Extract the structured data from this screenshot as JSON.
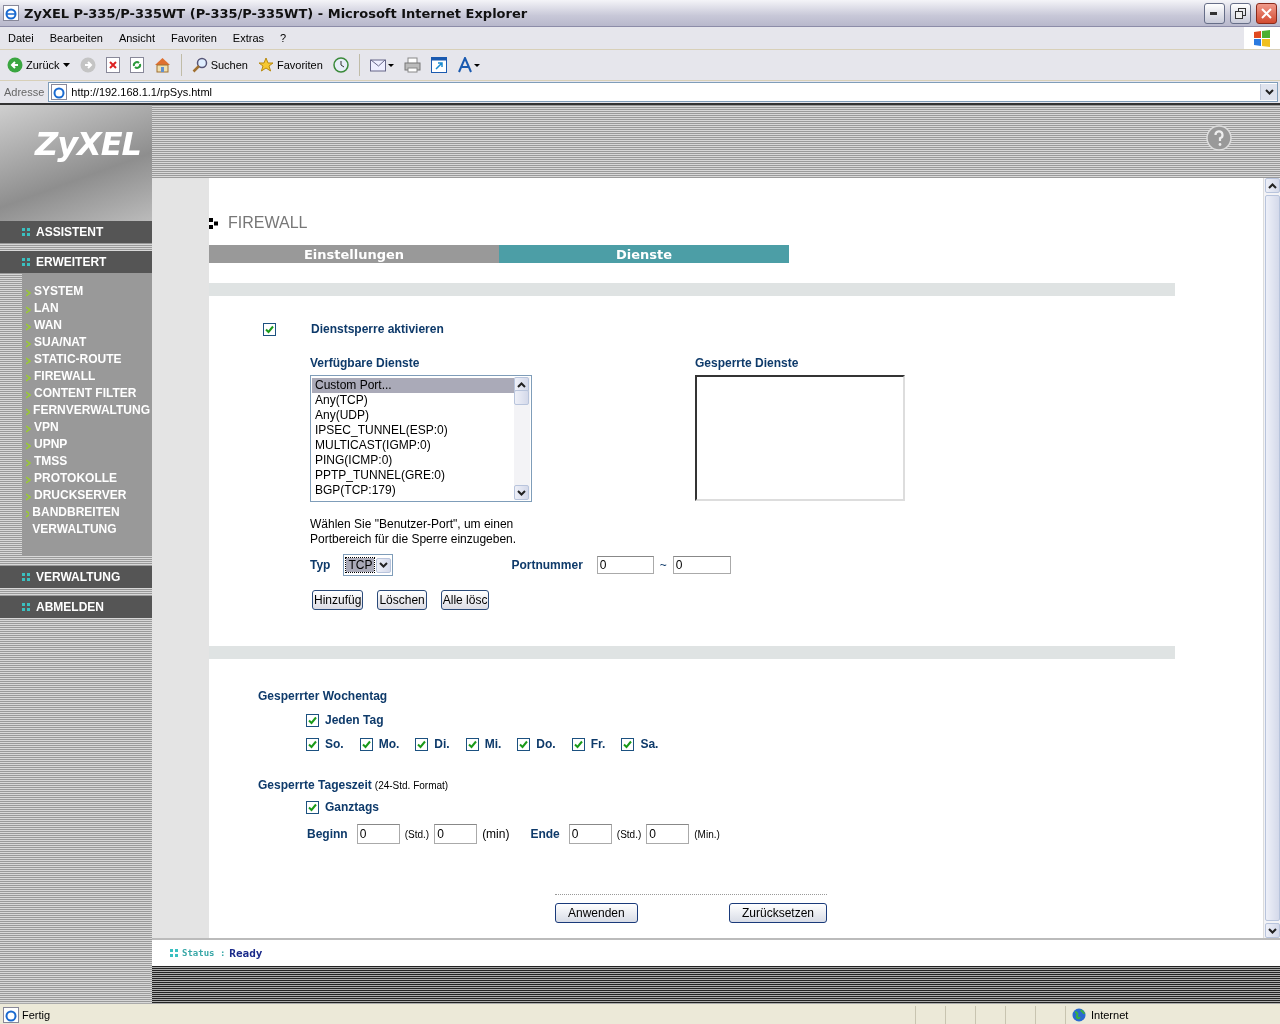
{
  "window": {
    "title": "ZyXEL P-335/P-335WT (P-335/P-335WT) - Microsoft Internet Explorer"
  },
  "menu": [
    "Datei",
    "Bearbeiten",
    "Ansicht",
    "Favoriten",
    "Extras",
    "?"
  ],
  "toolbar": [
    {
      "kind": "back",
      "label": "Zurück"
    },
    {
      "kind": "forward"
    },
    {
      "kind": "stop"
    },
    {
      "kind": "refresh"
    },
    {
      "kind": "home"
    },
    {
      "kind": "search",
      "label": "Suchen"
    },
    {
      "kind": "favorites",
      "label": "Favoriten"
    },
    {
      "kind": "history"
    },
    {
      "kind": "mail"
    },
    {
      "kind": "print"
    },
    {
      "kind": "window"
    },
    {
      "kind": "font"
    }
  ],
  "address": {
    "label": "Adresse",
    "url": "http://192.168.1.1/rpSys.html"
  },
  "logo": "ZyXEL",
  "nav": [
    {
      "label": "ASSISTENT"
    },
    {
      "label": "ERWEITERT",
      "children": [
        "SYSTEM",
        "LAN",
        "WAN",
        "SUA/NAT",
        "STATIC-ROUTE",
        "FIREWALL",
        "CONTENT FILTER",
        "FERNVERWALTUNG",
        "VPN",
        "UPNP",
        "TMSS",
        "PROTOKOLLE",
        "DRUCKSERVER",
        "BANDBREITEN VERWALTUNG"
      ]
    },
    {
      "label": "VERWALTUNG"
    },
    {
      "label": "ABMELDEN"
    }
  ],
  "page_title": "FIREWALL",
  "tabs": [
    {
      "label": "Einstellungen",
      "selected": false
    },
    {
      "label": "Dienste",
      "selected": true
    }
  ],
  "service_block": {
    "label": "Dienstsperre aktivieren",
    "checked": true
  },
  "available": {
    "heading": "Verfügbare Dienste",
    "items": [
      {
        "label": "Custom Port...",
        "selected": true
      },
      {
        "label": "Any(TCP)",
        "selected": false
      },
      {
        "label": "Any(UDP)",
        "selected": false
      },
      {
        "label": "IPSEC_TUNNEL(ESP:0)",
        "selected": false
      },
      {
        "label": "MULTICAST(IGMP:0)",
        "selected": false
      },
      {
        "label": "PING(ICMP:0)",
        "selected": false
      },
      {
        "label": "PPTP_TUNNEL(GRE:0)",
        "selected": false
      },
      {
        "label": "BGP(TCP:179)",
        "selected": false
      }
    ]
  },
  "blocked": {
    "heading": "Gesperrte Dienste"
  },
  "hint": "Wählen Sie \"Benutzer-Port\", um einen Portbereich für die Sperre einzugeben.",
  "type": {
    "label": "Typ",
    "value": "TCP"
  },
  "port": {
    "label": "Portnummer",
    "from": "0",
    "separator": "~",
    "to": "0"
  },
  "list_buttons": [
    "Hinzufüg",
    "Löschen",
    "Alle lösc"
  ],
  "weekday": {
    "heading": "Gesperrter Wochentag",
    "every_day": {
      "label": "Jeden Tag",
      "checked": true
    },
    "days": [
      {
        "label": "So.",
        "checked": true
      },
      {
        "label": "Mo.",
        "checked": true
      },
      {
        "label": "Di.",
        "checked": true
      },
      {
        "label": "Mi.",
        "checked": true
      },
      {
        "label": "Do.",
        "checked": true
      },
      {
        "label": "Fr.",
        "checked": true
      },
      {
        "label": "Sa.",
        "checked": true
      }
    ]
  },
  "time": {
    "heading": "Gesperrte Tageszeit",
    "note": "(24-Std. Format)",
    "all_day": {
      "label": "Ganztags",
      "checked": true
    },
    "begin_label": "Beginn",
    "begin_hour": "0",
    "begin_hour_unit": "(Std.)",
    "begin_min": "0",
    "begin_min_unit": "(min)",
    "end_label": "Ende",
    "end_hour": "0",
    "end_hour_unit": "(Std.)",
    "end_min": "0",
    "end_min_unit": "(Min.)"
  },
  "actions": [
    "Anwenden",
    "Zurücksetzen"
  ],
  "status": {
    "label": "Status :",
    "value": "Ready"
  },
  "ie_status": {
    "text": "Fertig",
    "zone": "Internet"
  }
}
